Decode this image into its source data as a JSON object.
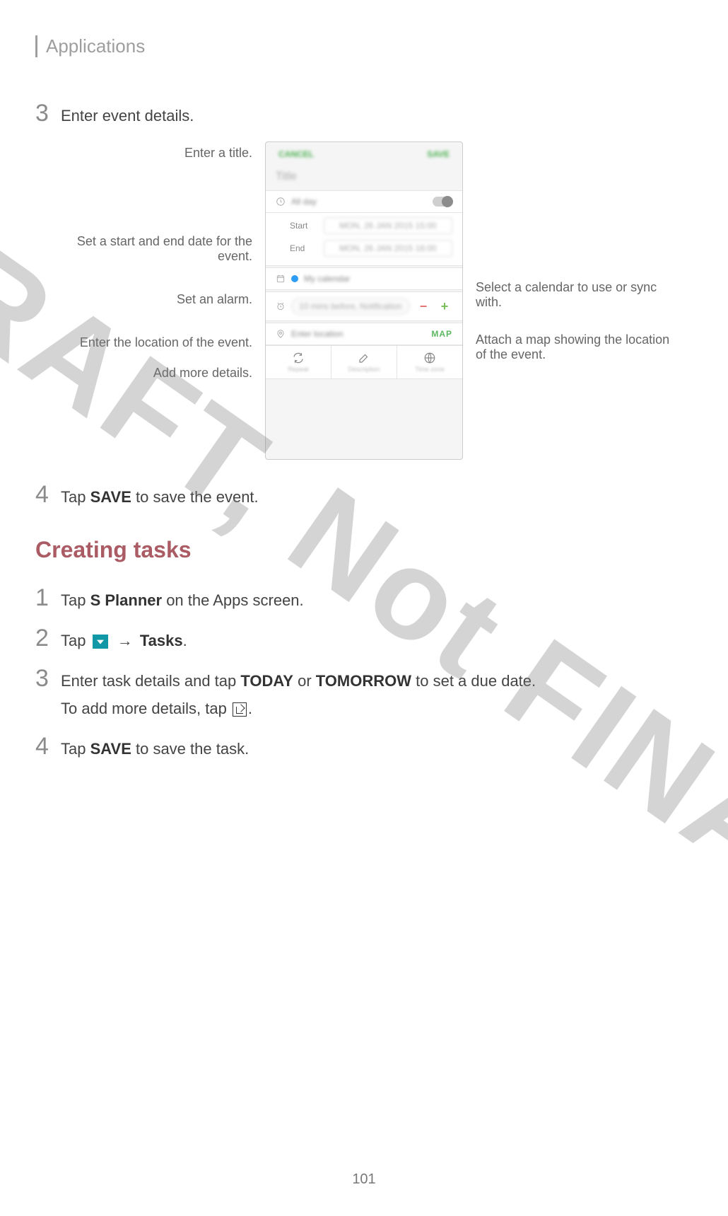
{
  "header": {
    "title": "Applications"
  },
  "steps_a": {
    "3": "Enter event details.",
    "4_pre": "Tap ",
    "4_bold": "SAVE",
    "4_post": " to save the event."
  },
  "figure": {
    "left": {
      "title": "Enter a title.",
      "dates": "Set a start and end date for the event.",
      "alarm": "Set an alarm.",
      "location": "Enter the location of the event.",
      "details": "Add more details."
    },
    "right": {
      "calendar": "Select a calendar to use or sync with.",
      "map": "Attach a map showing the location of the event."
    },
    "phone": {
      "cancel": "CANCEL",
      "save": "SAVE",
      "title_placeholder": "Title",
      "alllabel": "All day",
      "start_label": "Start",
      "end_label": "End",
      "start_value": "MON, 26 JAN 2015   15:00",
      "end_value": "MON, 26 JAN 2015   16:00",
      "calendar_label": "My calendar",
      "alarm_chip": "10 mins before, Notification",
      "location_placeholder": "Enter location",
      "map_label": "MAP",
      "detail_repeat": "Repeat",
      "detail_desc": "Description",
      "detail_tz": "Time zone"
    }
  },
  "section": {
    "tasks": "Creating tasks"
  },
  "steps_b": {
    "1_pre": "Tap ",
    "1_bold": "S Planner",
    "1_post": " on the Apps screen.",
    "2_pre": "Tap ",
    "2_arrow": " → ",
    "2_bold": "Tasks",
    "2_post": ".",
    "3_pre": "Enter task details and tap ",
    "3_bold1": "TODAY",
    "3_mid": " or ",
    "3_bold2": "TOMORROW",
    "3_post": " to set a due date.",
    "3_sub_pre": "To add more details, tap ",
    "3_sub_post": ".",
    "4_pre": "Tap ",
    "4_bold": "SAVE",
    "4_post": " to save the task."
  },
  "page_number": "101",
  "watermark": "DRAFT, Not FINAL"
}
